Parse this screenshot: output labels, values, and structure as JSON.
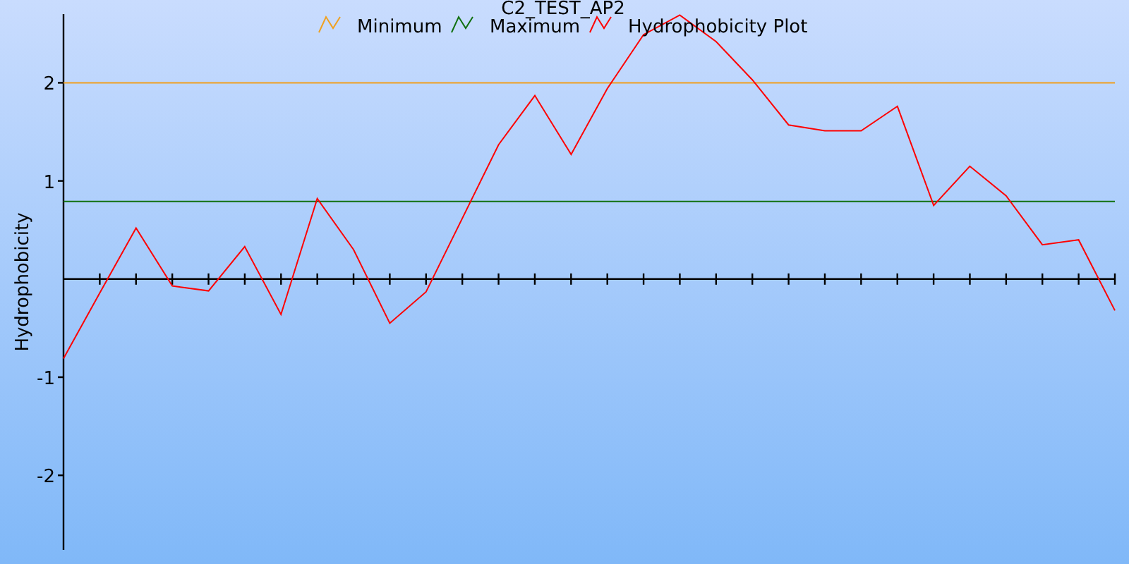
{
  "chart": {
    "chart_data": {
      "type": "line",
      "title": "C2_TEST_AP2",
      "ylabel": "Hydrophobicity",
      "legend": "top",
      "series": [
        {
          "name": "Minimum",
          "color": "#f0a020",
          "values": [
            2,
            2,
            2,
            2,
            2,
            2,
            2,
            2,
            2,
            2,
            2,
            2,
            2,
            2,
            2,
            2,
            2,
            2,
            2,
            2,
            2,
            2,
            2,
            2,
            2,
            2,
            2,
            2,
            2,
            2
          ]
        },
        {
          "name": "Maximum",
          "color": "#107010",
          "values": [
            0.79,
            0.79,
            0.79,
            0.79,
            0.79,
            0.79,
            0.79,
            0.79,
            0.79,
            0.79,
            0.79,
            0.79,
            0.79,
            0.79,
            0.79,
            0.79,
            0.79,
            0.79,
            0.79,
            0.79,
            0.79,
            0.79,
            0.79,
            0.79,
            0.79,
            0.79,
            0.79,
            0.79,
            0.79,
            0.79
          ]
        },
        {
          "name": "Hydrophobicity Plot",
          "color": "#ff0000",
          "values": [
            -0.81,
            -0.14,
            0.52,
            -0.07,
            -0.12,
            0.33,
            -0.36,
            0.82,
            0.3,
            -0.45,
            -0.13,
            0.62,
            1.37,
            1.87,
            1.27,
            1.94,
            2.49,
            2.69,
            2.42,
            2.03,
            1.57,
            1.51,
            1.51,
            1.76,
            0.75,
            1.15,
            0.85,
            0.35,
            0.4,
            -0.32
          ]
        }
      ],
      "ylim": [
        -2.76,
        2.7
      ],
      "yticks": [
        -2,
        -1,
        1,
        2
      ]
    }
  }
}
